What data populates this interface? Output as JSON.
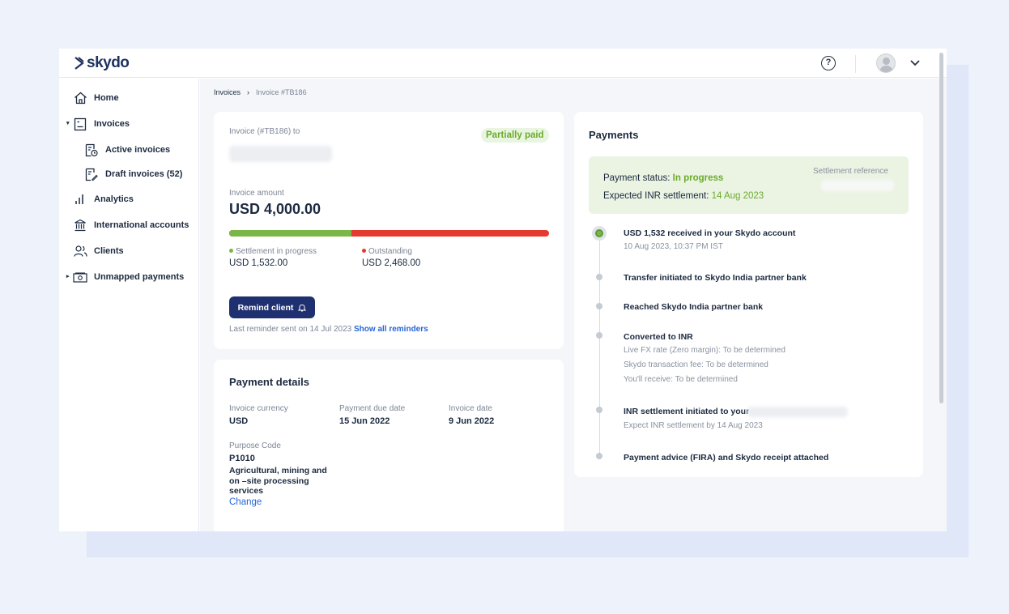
{
  "app": {
    "brand": "skydo"
  },
  "sidebar": {
    "items": [
      {
        "label": "Home",
        "icon": "home-icon"
      },
      {
        "label": "Invoices",
        "icon": "invoice-icon"
      },
      {
        "label": "Active invoices",
        "icon": "active-invoice-icon"
      },
      {
        "label": "Draft invoices (52)",
        "icon": "draft-invoice-icon"
      },
      {
        "label": "Analytics",
        "icon": "bar-chart-icon"
      },
      {
        "label": "International accounts",
        "icon": "bank-icon"
      },
      {
        "label": "Clients",
        "icon": "users-icon"
      },
      {
        "label": "Unmapped payments",
        "icon": "cash-icon"
      }
    ]
  },
  "breadcrumb": {
    "root": "Invoices",
    "sep": "›",
    "current": "Invoice #TB186"
  },
  "invoice": {
    "to_label": "Invoice (#TB186) to",
    "status": "Partially paid",
    "amount_label": "Invoice amount",
    "amount": "USD 4,000.00",
    "progress": {
      "settled_fraction": 0.383
    },
    "settlement_label": "Settlement in progress",
    "settlement_value": "USD 1,532.00",
    "outstanding_label": "Outstanding",
    "outstanding_value": "USD 2,468.00",
    "remind_button": "Remind client",
    "reminder_text": "Last reminder sent on 14 Jul 2023",
    "reminder_link": "Show all reminders"
  },
  "details": {
    "title": "Payment details",
    "currency_label": "Invoice currency",
    "currency_value": "USD",
    "due_label": "Payment due date",
    "due_value": "15 Jun 2022",
    "date_label": "Invoice date",
    "date_value": "9 Jun 2022",
    "purpose_label": "Purpose Code",
    "purpose_code": "P1010",
    "purpose_desc_1": "Agricultural, mining and",
    "purpose_desc_2": "on –site processing",
    "purpose_desc_3": "services",
    "change_link": "Change"
  },
  "payments": {
    "title": "Payments",
    "status_label": "Payment status:",
    "status_value": "In progress",
    "expected_label": "Expected INR settlement:",
    "expected_value": "14 Aug 2023",
    "ref_label": "Settlement reference",
    "timeline": {
      "t1_title": "USD 1,532 received in your Skydo account",
      "t1_sub": "10 Aug 2023, 10:37 PM IST",
      "t2_title": "Transfer initiated to Skydo India partner bank",
      "t3_title": "Reached Skydo India partner bank",
      "t4_title": "Converted to INR",
      "t4_sub1": "Live FX rate (Zero margin): To be determined",
      "t4_sub2": "Skydo transaction fee: To be determined",
      "t4_sub3": "You'll receive: To be determined",
      "t5_title": "INR settlement initiated to your",
      "t5_sub": "Expect INR settlement by 14 Aug 2023",
      "t6_title": "Payment advice (FIRA) and Skydo receipt attached"
    }
  },
  "colors": {
    "accent": "#1f3070",
    "green": "#7ab648",
    "red": "#e53a2f",
    "link": "#2766d8"
  }
}
